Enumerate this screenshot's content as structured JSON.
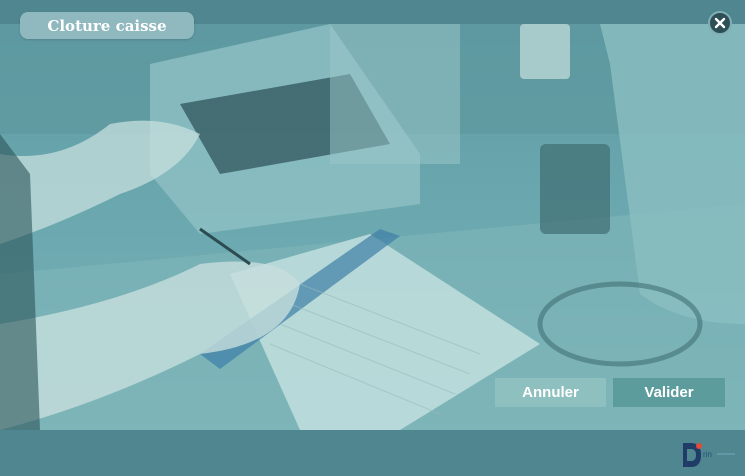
{
  "dialog": {
    "title": "Cloture caisse",
    "close_icon": "close-icon"
  },
  "background": {
    "description_icon": "photo-background",
    "tint_color": "#4f8690"
  },
  "actions": {
    "cancel_label": "Annuler",
    "confirm_label": "Valider",
    "cancel_color": "#8ec0bf",
    "confirm_color": "#5d9c9d"
  },
  "logo": {
    "icon": "brand-logo-icon",
    "text": "rin"
  }
}
